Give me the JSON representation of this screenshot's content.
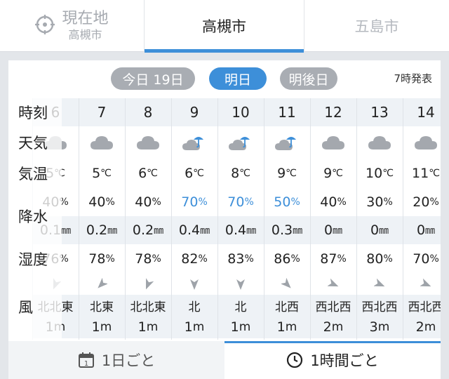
{
  "location_tabs": [
    {
      "label": "現在地",
      "sub": "高槻市"
    },
    {
      "label": "高槻市"
    },
    {
      "label": "五島市"
    }
  ],
  "day_tabs": {
    "today": "今日 19日",
    "tomorrow": "明日",
    "day_after": "明後日",
    "issued": "7時発表"
  },
  "row_labels": {
    "time": "時刻",
    "weather": "天気",
    "temp": "気温",
    "precip": "降水",
    "humidity": "湿度",
    "wind": "風"
  },
  "columns": [
    {
      "hour": "6",
      "weather": "cloudy",
      "temp": "5",
      "pop": "40",
      "precip": "0.1",
      "humid": "76",
      "wind": "北北東",
      "speed": "1"
    },
    {
      "hour": "7",
      "weather": "cloudy",
      "temp": "5",
      "pop": "40",
      "precip": "0.2",
      "humid": "78",
      "wind": "北東",
      "speed": "1"
    },
    {
      "hour": "8",
      "weather": "cloudy",
      "temp": "6",
      "pop": "40",
      "precip": "0.2",
      "humid": "78",
      "wind": "北北東",
      "speed": "1"
    },
    {
      "hour": "9",
      "weather": "rain",
      "temp": "6",
      "pop": "70",
      "precip": "0.4",
      "humid": "82",
      "wind": "北",
      "speed": "1"
    },
    {
      "hour": "10",
      "weather": "rain",
      "temp": "8",
      "pop": "70",
      "precip": "0.4",
      "humid": "83",
      "wind": "北",
      "speed": "1"
    },
    {
      "hour": "11",
      "weather": "rain",
      "temp": "9",
      "pop": "50",
      "precip": "0.3",
      "humid": "86",
      "wind": "北西",
      "speed": "1"
    },
    {
      "hour": "12",
      "weather": "cloudy",
      "temp": "9",
      "pop": "40",
      "precip": "0",
      "humid": "87",
      "wind": "西北西",
      "speed": "2"
    },
    {
      "hour": "13",
      "weather": "cloudy",
      "temp": "10",
      "pop": "30",
      "precip": "0",
      "humid": "80",
      "wind": "西北西",
      "speed": "3"
    },
    {
      "hour": "14",
      "weather": "cloudy",
      "temp": "11",
      "pop": "20",
      "precip": "0",
      "humid": "70",
      "wind": "西北西",
      "speed": "2"
    }
  ],
  "units": {
    "temp": "℃",
    "pop": "%",
    "precip": "㎜",
    "humid": "%",
    "speed": "m"
  },
  "bottom_tabs": {
    "daily": "1日ごと",
    "hourly": "1時間ごと"
  },
  "colors": {
    "accent": "#3d8fd9",
    "inactive_pill": "#a9adb3"
  }
}
